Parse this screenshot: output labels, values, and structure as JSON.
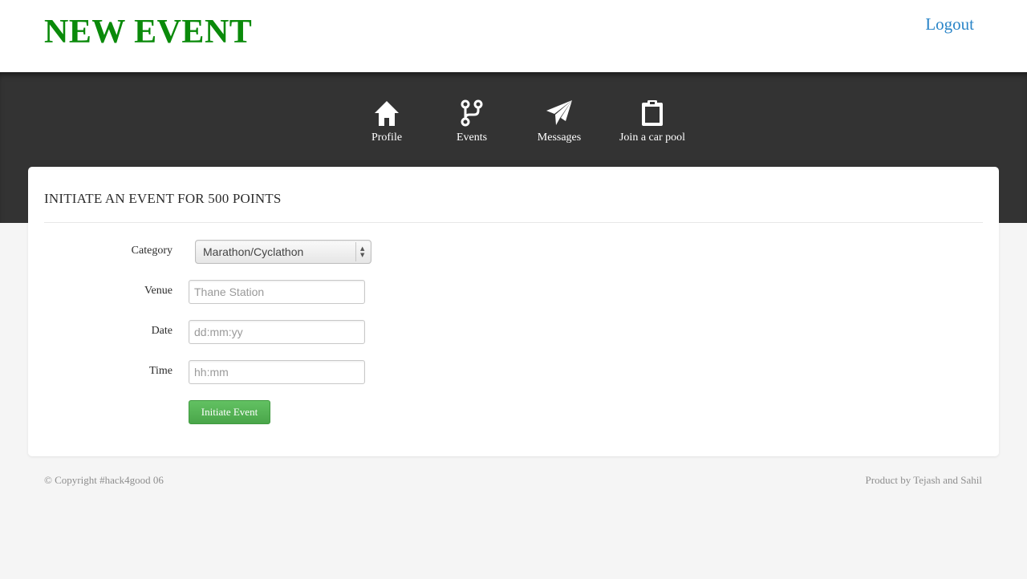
{
  "header": {
    "title": "NEW EVENT",
    "logout_label": "Logout",
    "title_color": "#0a8a0a",
    "link_color": "#2a85c8"
  },
  "nav": {
    "items": [
      {
        "label": "Profile",
        "icon": "home-icon"
      },
      {
        "label": "Events",
        "icon": "branch-icon"
      },
      {
        "label": "Messages",
        "icon": "paper-plane-icon"
      },
      {
        "label": "Join a car pool",
        "icon": "clipboard-icon"
      }
    ]
  },
  "form": {
    "heading": "INITIATE AN EVENT FOR 500 POINTS",
    "category": {
      "label": "Category",
      "value": "Marathon/Cyclathon"
    },
    "venue": {
      "label": "Venue",
      "placeholder": "Thane Station"
    },
    "date": {
      "label": "Date",
      "placeholder": "dd:mm:yy"
    },
    "time": {
      "label": "Time",
      "placeholder": "hh:mm"
    },
    "submit_label": "Initiate Event",
    "button_color": "#55b355"
  },
  "footer": {
    "copyright": "© Copyright #hack4good 06",
    "credit": "Product by Tejash and Sahil"
  }
}
